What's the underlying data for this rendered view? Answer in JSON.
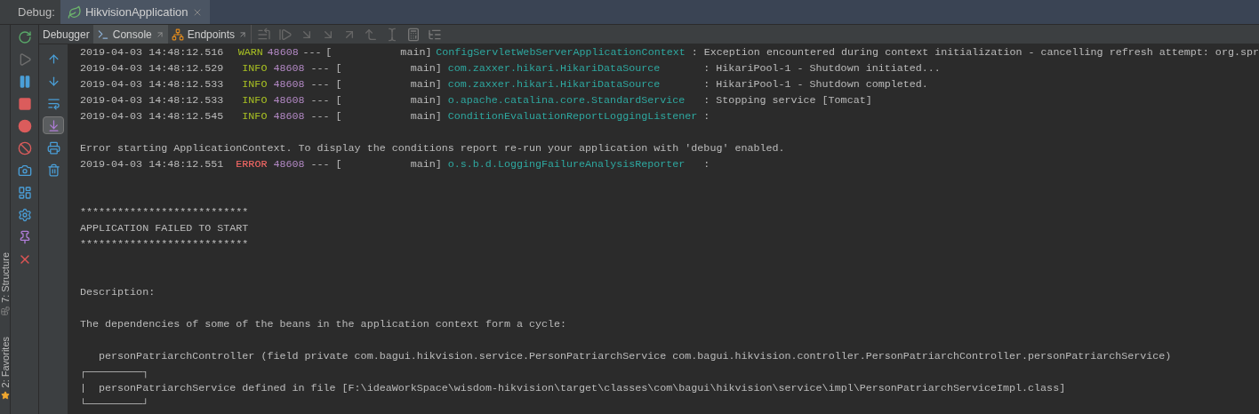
{
  "header": {
    "label": "Debug:",
    "tabs": [
      {
        "title": "HikvisionApplication",
        "selected": true
      }
    ]
  },
  "toolbar": {
    "tabs": [
      {
        "label": "Debugger",
        "kind": "plain",
        "selected": false
      },
      {
        "label": "Console",
        "kind": "console",
        "selected": true
      },
      {
        "label": "Endpoints",
        "kind": "endpoints",
        "selected": false
      }
    ]
  },
  "side_tabs": [
    {
      "label": "7: Structure",
      "kind": "structure"
    },
    {
      "label": "2: Favorites",
      "kind": "favorites"
    }
  ],
  "console_actions": [
    {
      "kind": "up",
      "selected": false
    },
    {
      "kind": "down",
      "selected": false
    },
    {
      "kind": "wrap",
      "selected": false
    },
    {
      "kind": "scroll-end",
      "selected": true
    },
    {
      "kind": "print",
      "selected": false
    },
    {
      "kind": "trash",
      "selected": false
    }
  ],
  "console": {
    "lines": [
      {
        "kind": "log",
        "timestamp": "2019-04-03 14:48:12.516",
        "severity": {
          "text": "WARN",
          "color": "#a8c023"
        },
        "pid": "48608",
        "separator": "---",
        "thread": "[           main]",
        "logger": "ConfigServletWebServerApplicationContext",
        "message": ": Exception encountered during context initialization - cancelling refresh attempt: org.spr"
      },
      {
        "kind": "log",
        "timestamp": "2019-04-03 14:48:12.529",
        "severity": {
          "text": "INFO",
          "color": "#a8c023"
        },
        "pid": "48608",
        "separator": "---",
        "thread": "[           main]",
        "logger": "com.zaxxer.hikari.HikariDataSource",
        "message": ": HikariPool-1 - Shutdown initiated..."
      },
      {
        "kind": "log",
        "timestamp": "2019-04-03 14:48:12.533",
        "severity": {
          "text": "INFO",
          "color": "#a8c023"
        },
        "pid": "48608",
        "separator": "---",
        "thread": "[           main]",
        "logger": "com.zaxxer.hikari.HikariDataSource",
        "message": ": HikariPool-1 - Shutdown completed."
      },
      {
        "kind": "log",
        "timestamp": "2019-04-03 14:48:12.533",
        "severity": {
          "text": "INFO",
          "color": "#a8c023"
        },
        "pid": "48608",
        "separator": "---",
        "thread": "[           main]",
        "logger": "o.apache.catalina.core.StandardService",
        "message": ": Stopping service [Tomcat]"
      },
      {
        "kind": "log",
        "timestamp": "2019-04-03 14:48:12.545",
        "severity": {
          "text": "INFO",
          "color": "#a8c023"
        },
        "pid": "48608",
        "separator": "---",
        "thread": "[           main]",
        "logger": "ConditionEvaluationReportLoggingListener",
        "message": ":"
      },
      {
        "kind": "blank"
      },
      {
        "kind": "text",
        "text": "Error starting ApplicationContext. To display the conditions report re-run your application with 'debug' enabled."
      },
      {
        "kind": "log",
        "timestamp": "2019-04-03 14:48:12.551",
        "severity": {
          "text": "ERROR",
          "color": "#ff6b68"
        },
        "pid": "48608",
        "separator": "---",
        "thread": "[           main]",
        "logger": "o.s.b.d.LoggingFailureAnalysisReporter",
        "message": ":"
      },
      {
        "kind": "blank"
      },
      {
        "kind": "blank"
      },
      {
        "kind": "text",
        "text": "***************************"
      },
      {
        "kind": "text",
        "text": "APPLICATION FAILED TO START"
      },
      {
        "kind": "text",
        "text": "***************************"
      },
      {
        "kind": "blank"
      },
      {
        "kind": "blank"
      },
      {
        "kind": "text",
        "text": "Description:"
      },
      {
        "kind": "blank"
      },
      {
        "kind": "text",
        "text": "The dependencies of some of the beans in the application context form a cycle:"
      },
      {
        "kind": "blank"
      },
      {
        "kind": "text",
        "text": "   personPatriarchController (field private com.bagui.hikvision.service.PersonPatriarchService com.bagui.hikvision.controller.PersonPatriarchController.personPatriarchService)"
      },
      {
        "kind": "text",
        "text": "┌─────────┐"
      },
      {
        "kind": "text",
        "text": "|  personPatriarchService defined in file [F:\\ideaWorkSpace\\wisdom-hikvision\\target\\classes\\com\\bagui\\hikvision\\service\\impl\\PersonPatriarchServiceImpl.class]"
      },
      {
        "kind": "text",
        "text": "└─────────┘"
      }
    ]
  }
}
